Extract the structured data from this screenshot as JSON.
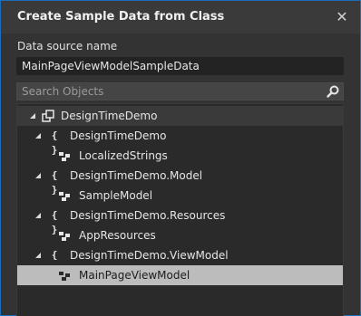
{
  "dialog": {
    "title": "Create Sample Data from Class",
    "close_glyph": "✕"
  },
  "datasource": {
    "label": "Data source name",
    "value": "MainPageViewModelSampleData"
  },
  "search": {
    "placeholder": "Search Objects",
    "icon": "search-icon"
  },
  "tree": {
    "items": [
      {
        "label": "DesignTimeDemo",
        "kind": "assembly",
        "expanded": true
      },
      {
        "label": "DesignTimeDemo",
        "kind": "namespace",
        "expanded": true
      },
      {
        "label": "LocalizedStrings",
        "kind": "class"
      },
      {
        "label": "DesignTimeDemo.Model",
        "kind": "namespace",
        "expanded": true
      },
      {
        "label": "SampleModel",
        "kind": "class"
      },
      {
        "label": "DesignTimeDemo.Resources",
        "kind": "namespace",
        "expanded": true
      },
      {
        "label": "AppResources",
        "kind": "class"
      },
      {
        "label": "DesignTimeDemo.ViewModel",
        "kind": "namespace",
        "expanded": true
      },
      {
        "label": "MainPageViewModel",
        "kind": "class",
        "selected": true
      }
    ],
    "namespace_glyph": "{ }"
  },
  "colors": {
    "accent_border": "#1a6fb8",
    "selection": "#bcbcbc",
    "background": "#333333"
  }
}
